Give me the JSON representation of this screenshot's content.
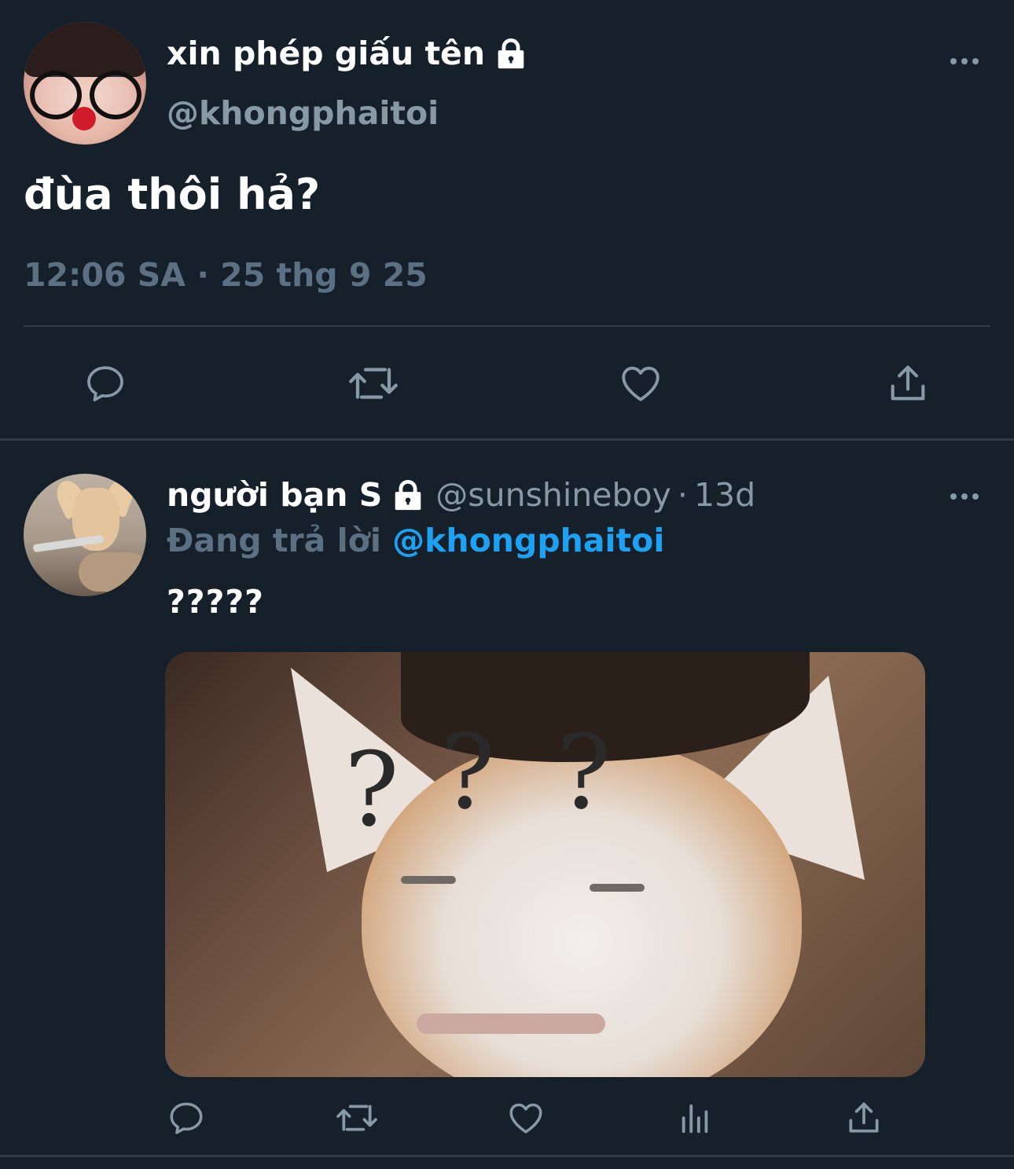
{
  "main_tweet": {
    "display_name": "xin phép giấu tên",
    "handle": "@khongphaitoi",
    "text": "đùa thôi hả?",
    "timestamp": "12:06 SA · 25 thg 9 25",
    "actions": [
      "reply-icon",
      "retweet-icon",
      "like-icon",
      "share-icon"
    ]
  },
  "reply_tweet": {
    "display_name": "người bạn S",
    "handle": "@sunshineboy",
    "separator": "·",
    "age": "13d",
    "replying_prefix": "Đang trả lời",
    "replying_to": "@khongphaitoi",
    "text": "?????",
    "actions": [
      "reply-icon",
      "retweet-icon",
      "like-icon",
      "analytics-icon",
      "share-icon"
    ]
  },
  "colors": {
    "background": "#15202b",
    "secondary_text": "#8899a6",
    "muted_text": "#5b7083",
    "link": "#1da1f2",
    "divider": "#2f3b47"
  }
}
